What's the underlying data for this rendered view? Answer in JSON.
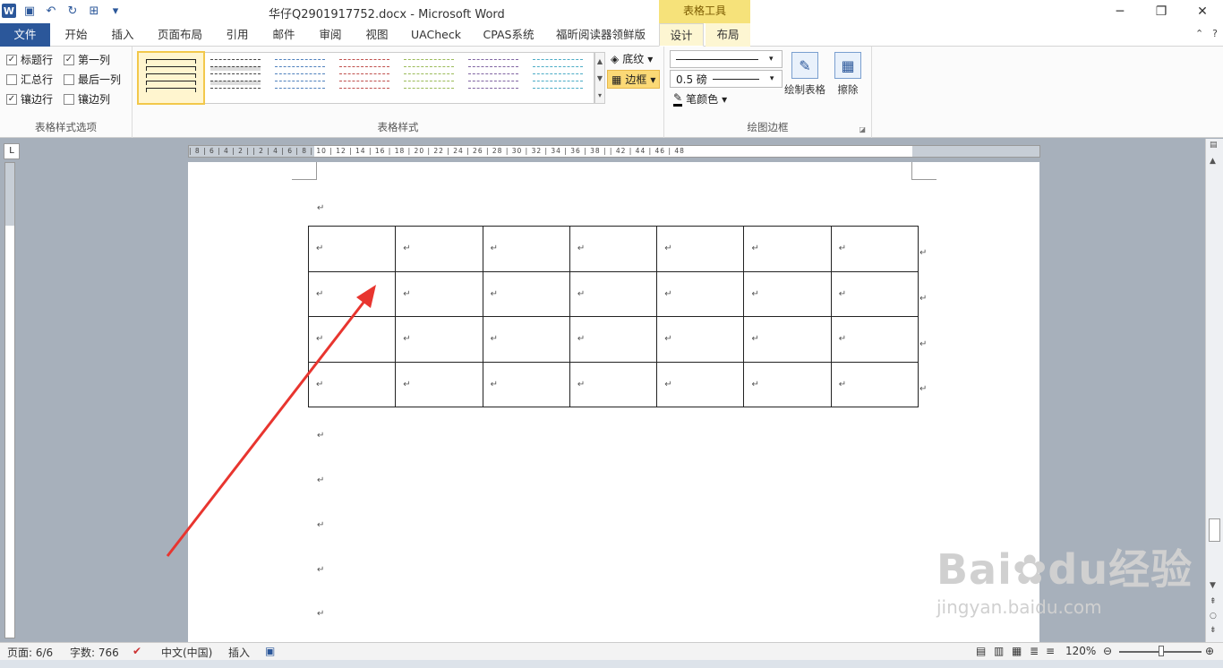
{
  "window": {
    "title": "华仔Q2901917752.docx - Microsoft Word",
    "context_title": "表格工具",
    "controls": [
      "─",
      "❐",
      "✕"
    ]
  },
  "tabs": [
    {
      "label": "文件",
      "kind": "file"
    },
    {
      "label": "开始"
    },
    {
      "label": "插入"
    },
    {
      "label": "页面布局"
    },
    {
      "label": "引用"
    },
    {
      "label": "邮件"
    },
    {
      "label": "审阅"
    },
    {
      "label": "视图"
    },
    {
      "label": "UACheck"
    },
    {
      "label": "CPAS系统"
    },
    {
      "label": "福昕阅读器领鲜版"
    },
    {
      "label": "设计",
      "active": true
    },
    {
      "label": "布局"
    }
  ],
  "ribbon": {
    "style_options": {
      "label": "表格样式选项",
      "items": [
        {
          "label": "标题行",
          "checked": true
        },
        {
          "label": "第一列",
          "checked": true
        },
        {
          "label": "汇总行",
          "checked": false
        },
        {
          "label": "最后一列",
          "checked": false
        },
        {
          "label": "镶边行",
          "checked": true
        },
        {
          "label": "镶边列",
          "checked": false
        }
      ]
    },
    "table_styles": {
      "label": "表格样式",
      "swatches": [
        "#222222",
        "#444444",
        "#4f81bd",
        "#c0504d",
        "#9bbb59",
        "#8064a2",
        "#4bacc6"
      ]
    },
    "shading_label": "底纹",
    "border_label": "边框",
    "draw_borders": {
      "label": "绘图边框",
      "line_weight": "0.5 磅",
      "pen_color": "笔颜色",
      "draw_table": "绘制表格",
      "eraser": "擦除"
    }
  },
  "ruler": {
    "h_ticks": "| 8 |  6 |  4 |  2 |    | 2 |  4 |  6 |  8 | 10 | 12 | 14 | 16 | 18 | 20 | 22 | 24 | 26 | 28 | 30 | 32 | 34 | 36 | 38 |  | 42 | 44 | 46 | 48"
  },
  "document": {
    "pilcrow": "↵",
    "table": {
      "rows": 4,
      "cols": 7
    }
  },
  "status": {
    "page": "页面: 6/6",
    "words": "字数: 766",
    "language": "中文(中国)",
    "mode": "插入",
    "zoom": "120%"
  },
  "watermark": {
    "brand": "Bai",
    "brand2": "du",
    "cn": "经验",
    "url": "jingyan.baidu.com"
  }
}
